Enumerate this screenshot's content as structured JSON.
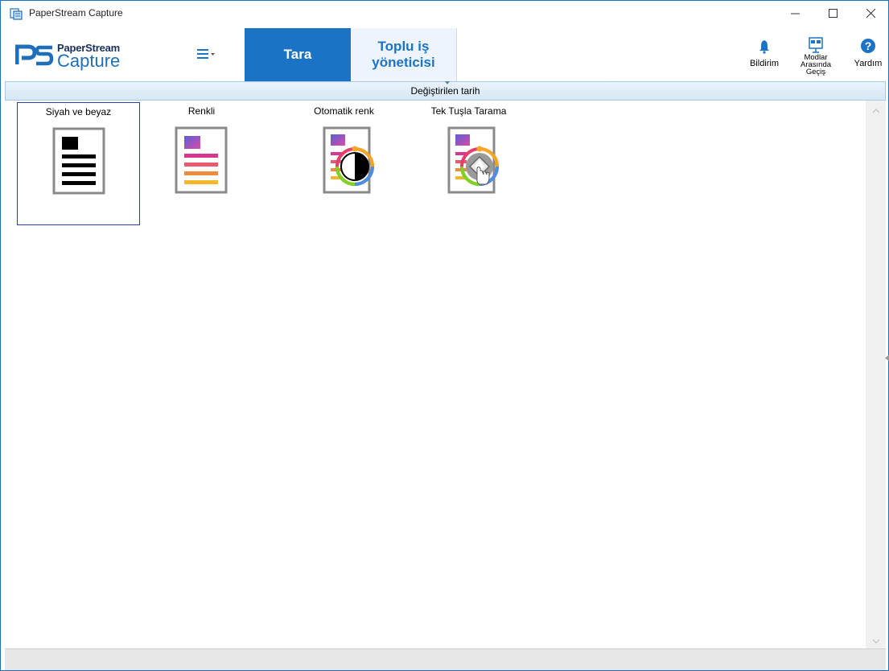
{
  "window": {
    "title": "PaperStream Capture",
    "controls": {
      "minimize": "—",
      "maximize": "☐",
      "close": "✕"
    }
  },
  "ribbon": {
    "logo": {
      "brand_top": "PaperStream",
      "brand_bottom": "Capture"
    },
    "menu_icon": "hamburger-menu-icon",
    "tabs": [
      {
        "label": "Tara",
        "active": true
      },
      {
        "label_line1": "Toplu iş",
        "label_line2": "yöneticisi",
        "active": false
      }
    ],
    "tools": [
      {
        "label": "Bildirim",
        "icon": "bell-icon"
      },
      {
        "label_line1": "Modlar",
        "label_line2": "Arasında",
        "label_line3": "Geçiş",
        "icon": "mode-switch-icon"
      },
      {
        "label": "Yardım",
        "icon": "help-icon"
      }
    ]
  },
  "sort_header": {
    "label": "Değiştirilen tarih"
  },
  "profiles": [
    {
      "name": "Siyah ve beyaz",
      "icon": "black-white-document-icon",
      "selected": true
    },
    {
      "name": "Renkli",
      "icon": "color-document-icon",
      "selected": false
    },
    {
      "name": "Otomatik renk",
      "icon": "auto-color-document-icon",
      "selected": false
    },
    {
      "name": "Tek Tuşla Tarama",
      "icon": "one-touch-scan-icon",
      "selected": false
    }
  ],
  "colors": {
    "accent": "#1b73c6",
    "selection_border": "#2b3cb8",
    "header_bg": "#d6e7f6"
  }
}
